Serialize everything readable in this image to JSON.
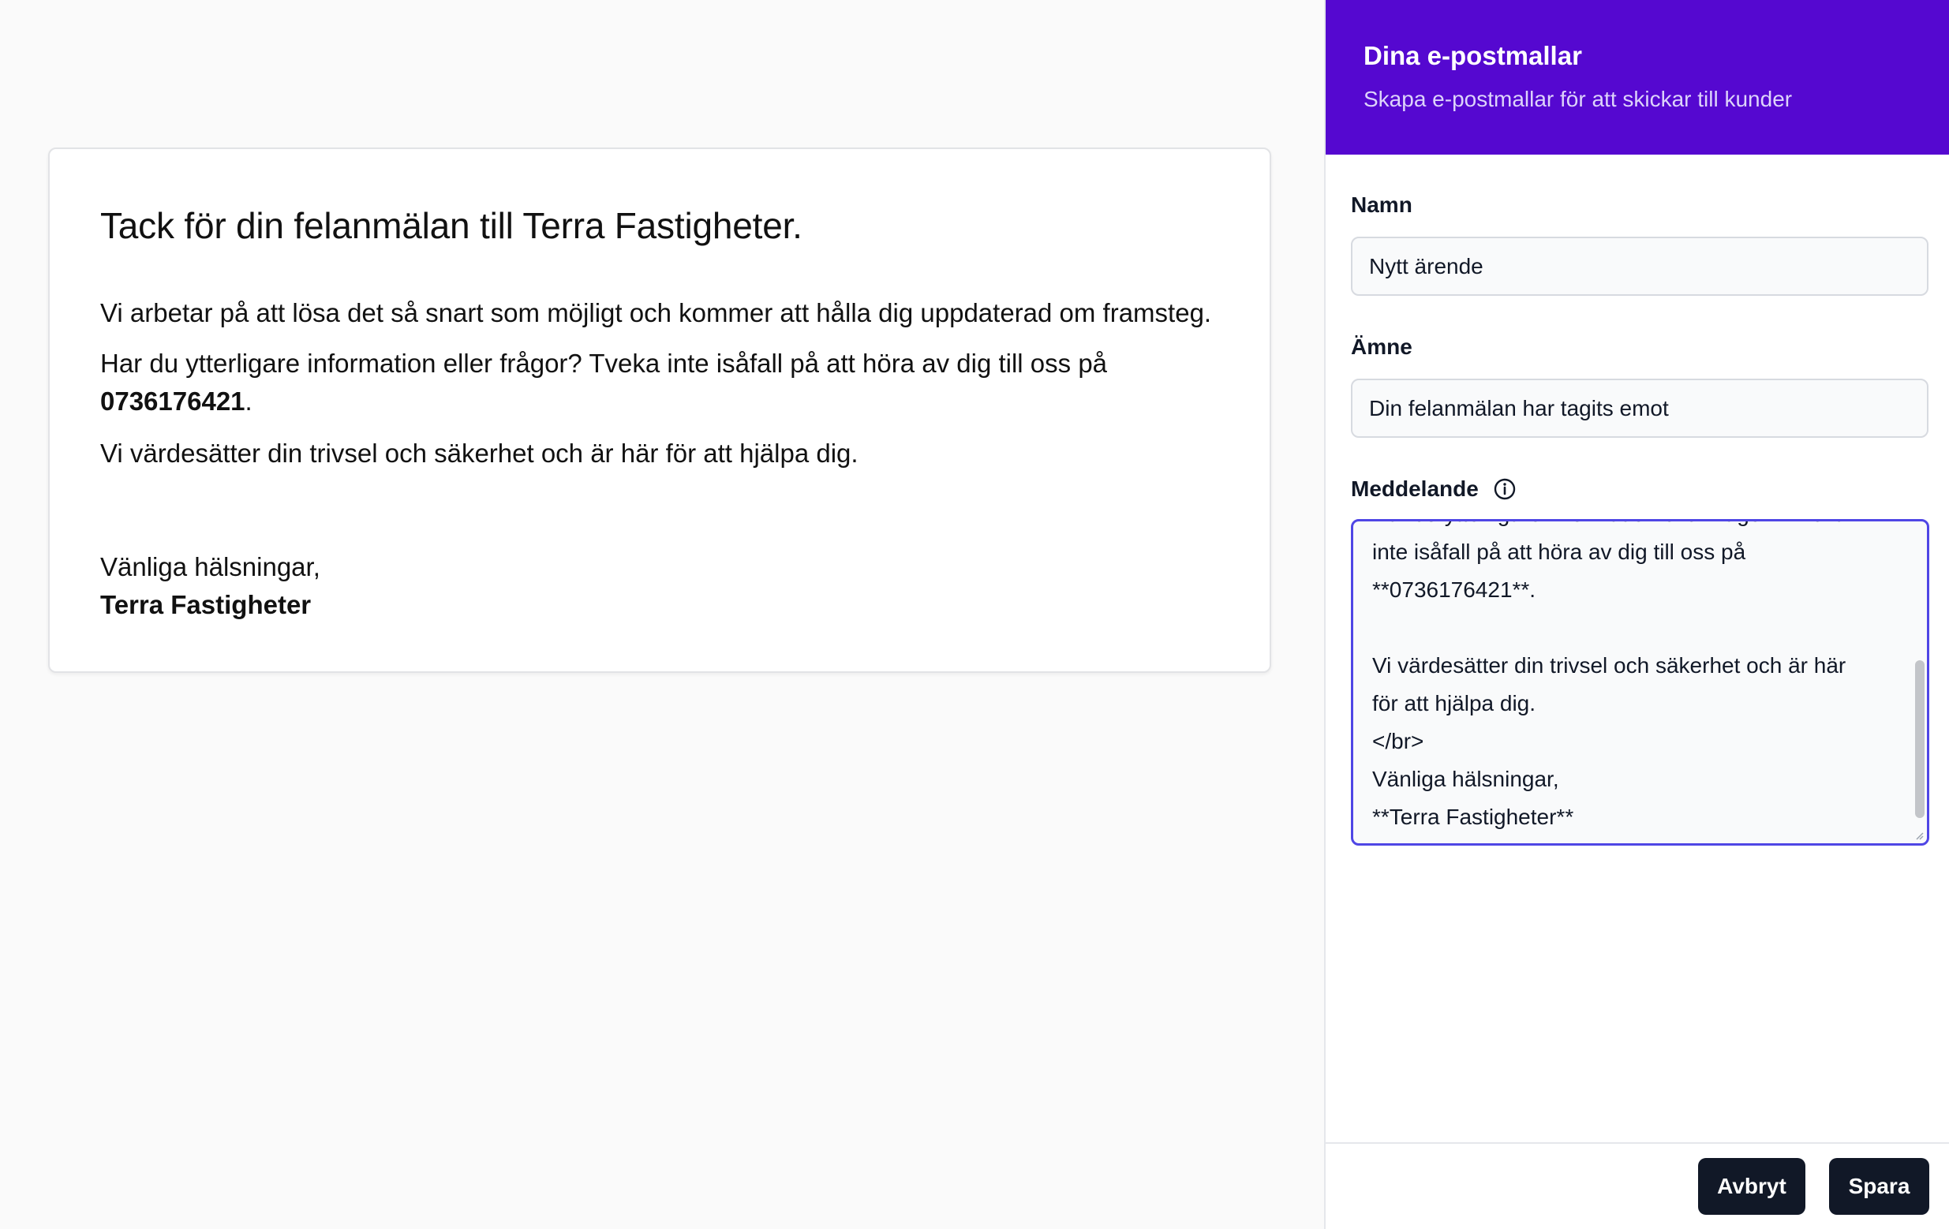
{
  "preview": {
    "heading": "Tack för din felanmälan till Terra Fastigheter.",
    "paragraph1": "Vi arbetar på att lösa det så snart som möjligt och kommer att hålla dig uppdaterad om framsteg.",
    "paragraph2_text": "Har du ytterligare information eller frågor? Tveka inte isåfall på att höra av dig till oss på ",
    "paragraph2_phone": "0736176421",
    "paragraph2_end": ".",
    "paragraph3": "Vi värdesätter din trivsel och säkerhet och är här för att hjälpa dig.",
    "greeting": "Vänliga hälsningar,",
    "signature": "Terra Fastigheter"
  },
  "panel": {
    "title": "Dina e-postmallar",
    "subtitle": "Skapa e-postmallar för att skickar till kunder",
    "name_label": "Namn",
    "name_value": "Nytt ärende",
    "subject_label": "Ämne",
    "subject_value": "Din felanmälan har tagits emot",
    "message_label": "Meddelande",
    "message_value": "Har du ytterligare information eller frågor? Tveka\ninte isåfall på att höra av dig till oss på\n**0736176421**.\n\nVi värdesätter din trivsel och säkerhet och är här\nför att hjälpa dig.\n</br>\nVänliga hälsningar,\n**Terra Fastigheter**",
    "cancel_label": "Avbryt",
    "save_label": "Spara"
  },
  "colors": {
    "header_bg": "#5508d0",
    "focus_ring": "#4f46e5",
    "button_bg": "#111827"
  },
  "icons": {
    "message_info": "info-icon"
  }
}
